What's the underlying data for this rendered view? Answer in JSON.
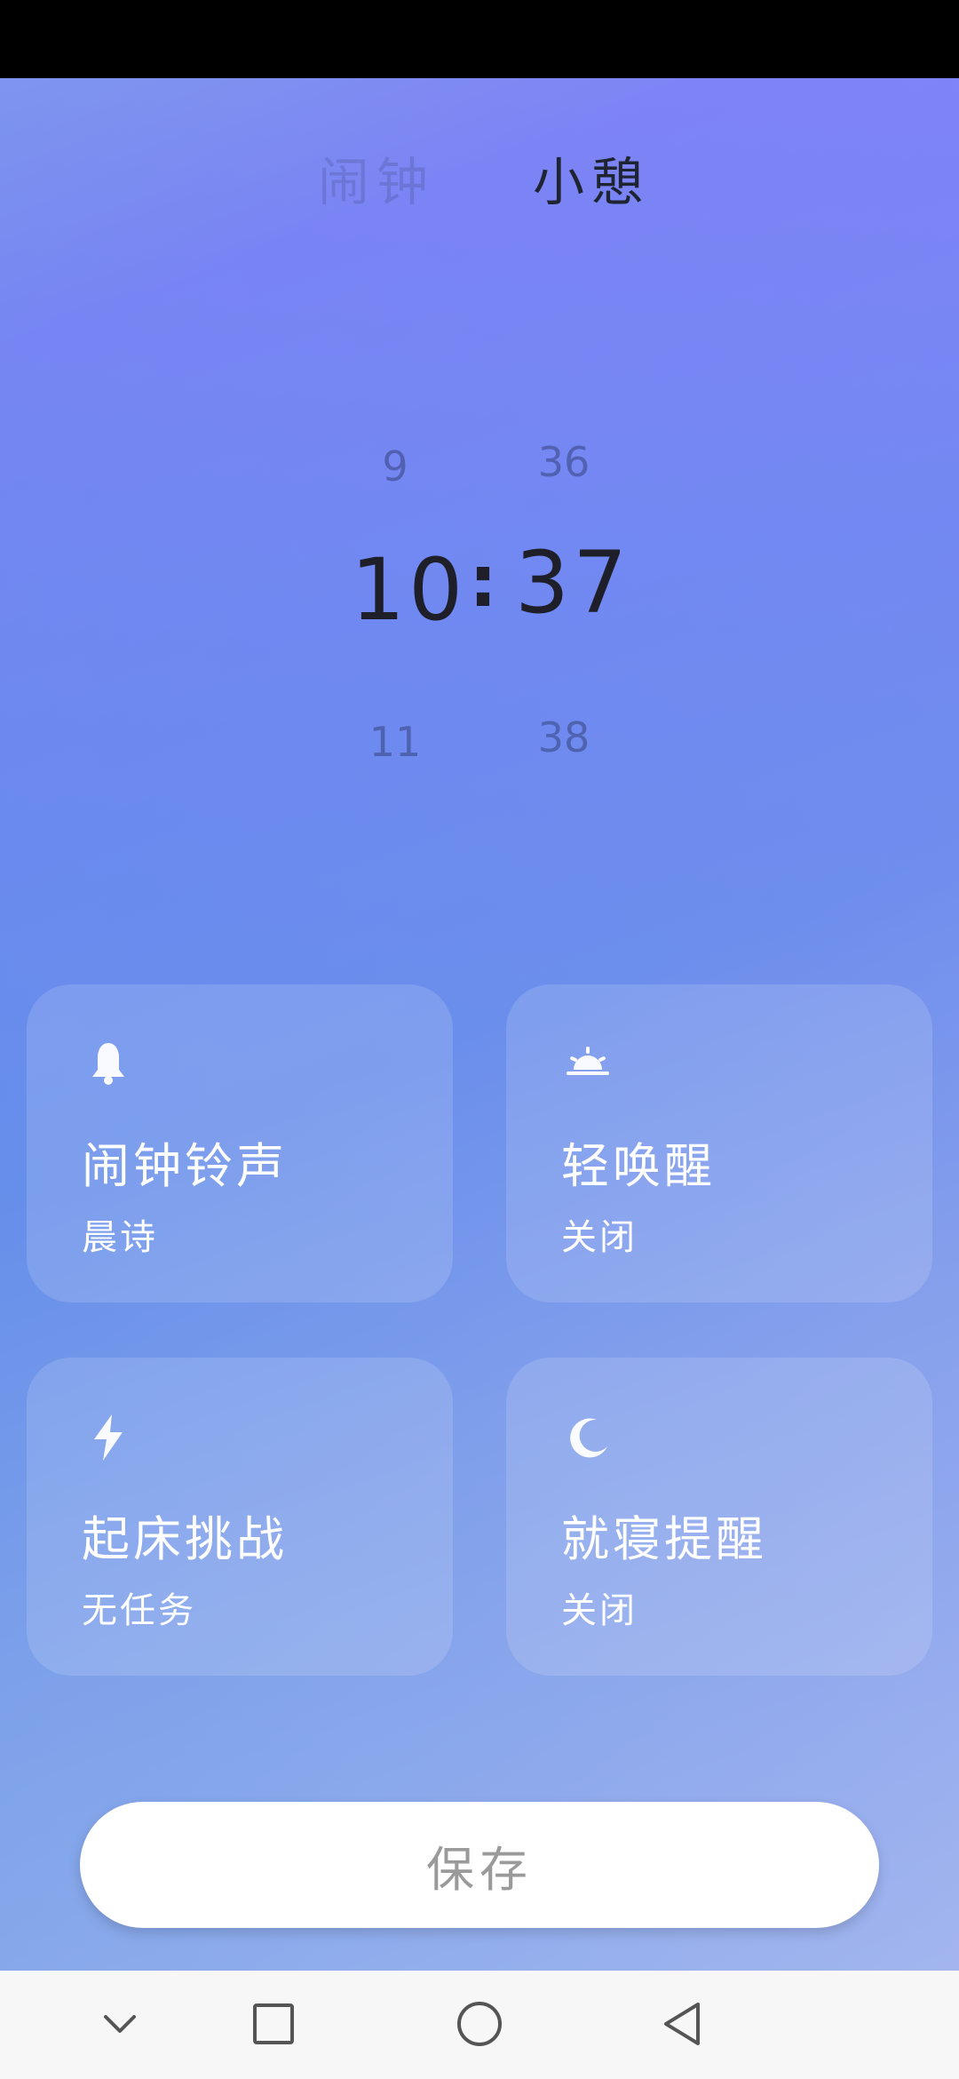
{
  "tabs": {
    "alarm": "闹钟",
    "nap": "小憩"
  },
  "picker": {
    "hour_prev": "9",
    "hour_current": "10",
    "hour_next": "11",
    "separator": ":",
    "minute_prev": "36",
    "minute_current": "37",
    "minute_next": "38"
  },
  "cards": [
    {
      "icon": "bell-icon",
      "title": "闹钟铃声",
      "sub": "晨诗"
    },
    {
      "icon": "sunrise-icon",
      "title": "轻唤醒",
      "sub": "关闭"
    },
    {
      "icon": "lightning-icon",
      "title": "起床挑战",
      "sub": "无任务"
    },
    {
      "icon": "moon-icon",
      "title": "就寝提醒",
      "sub": "关闭"
    }
  ],
  "save_label": "保存",
  "navbar": {
    "icons": [
      "chevron-down-icon",
      "square-icon",
      "circle-icon",
      "back-triangle-icon"
    ]
  },
  "colors": {
    "card_text": "#ffffff",
    "active_tab": "#1f2433",
    "save_text": "#9a9a9a"
  }
}
